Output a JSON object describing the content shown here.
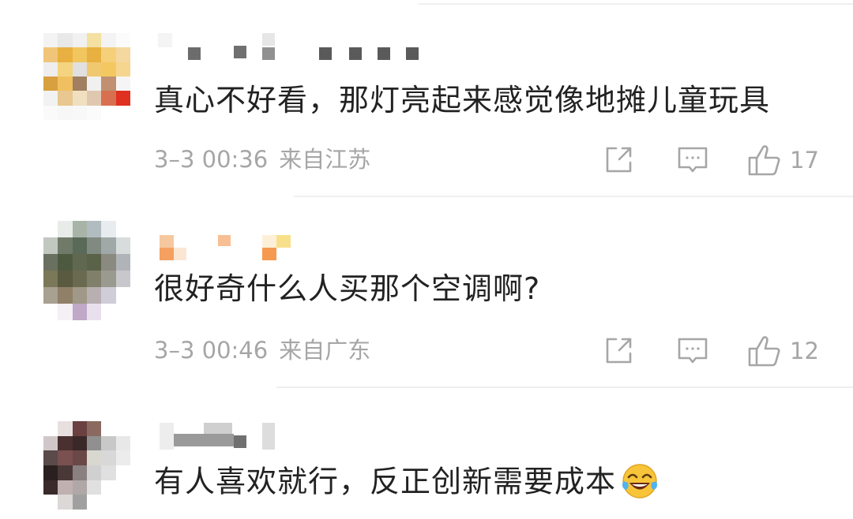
{
  "comments": [
    {
      "text": "真心不好看，那灯亮起来感觉像地摊儿童玩具",
      "time": "3–3 00:36",
      "location": "来自江苏",
      "likes": "17",
      "avatar_icon": "pixelated-avatar",
      "username_icon": "pixelated-username"
    },
    {
      "text": "很好奇什么人买那个空调啊?",
      "time": "3–3 00:46",
      "location": "来自广东",
      "likes": "12",
      "avatar_icon": "pixelated-avatar",
      "username_icon": "pixelated-username"
    },
    {
      "text": "有人喜欢就行，反正创新需要成本",
      "emoji": "tears-of-joy-emoji",
      "avatar_icon": "pixelated-avatar",
      "username_icon": "pixelated-username"
    }
  ],
  "icons": {
    "share": "share-icon",
    "reply": "reply-icon",
    "like": "thumbs-up-icon"
  },
  "colors": {
    "text": "#222222",
    "meta": "#a6a6a6",
    "divider": "#efefef"
  }
}
